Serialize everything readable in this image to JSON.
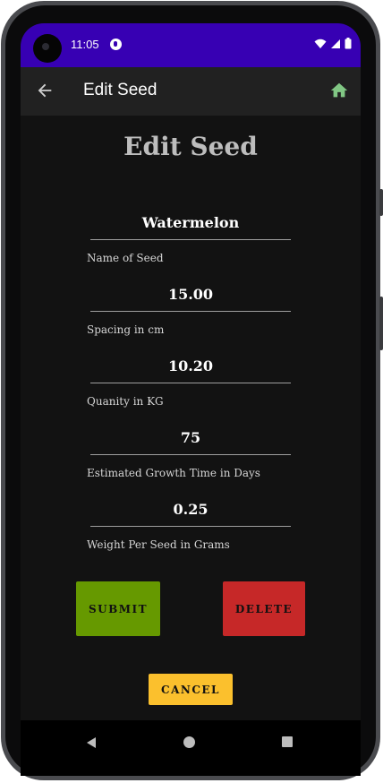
{
  "status_bar": {
    "time": "11:05",
    "icons": [
      "wifi-icon",
      "cell-signal-icon",
      "battery-icon"
    ]
  },
  "app_bar": {
    "title": "Edit Seed",
    "back_icon": "arrow-left-icon",
    "home_icon": "home-icon",
    "home_color": "#81c784"
  },
  "page": {
    "title": "Edit Seed"
  },
  "fields": [
    {
      "value": "Watermelon",
      "label": "Name of Seed"
    },
    {
      "value": "15.00",
      "label": "Spacing in cm"
    },
    {
      "value": "10.20",
      "label": "Quanity in KG"
    },
    {
      "value": "75",
      "label": "Estimated Growth Time in Days"
    },
    {
      "value": "0.25",
      "label": "Weight Per Seed in Grams"
    }
  ],
  "buttons": {
    "submit": {
      "label": "SUBMIT",
      "color": "#669900"
    },
    "delete": {
      "label": "DELETE",
      "color": "#c62828"
    },
    "cancel": {
      "label": "CANCEL",
      "color": "#fbc02d"
    }
  },
  "colors": {
    "status_bar": "#3700b3",
    "app_bar": "#212121",
    "background": "#121212"
  }
}
